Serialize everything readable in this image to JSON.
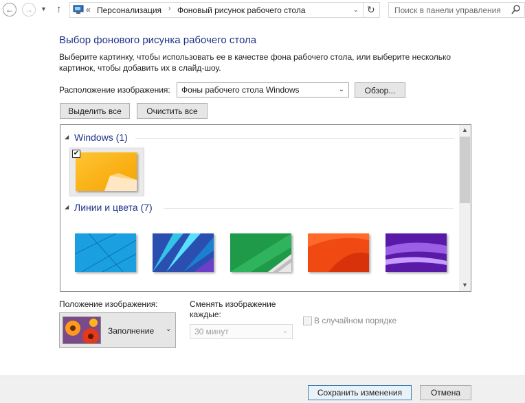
{
  "address": {
    "prefix": "«",
    "crumbs": [
      "Персонализация",
      "Фоновый рисунок рабочего стола"
    ],
    "search_placeholder": "Поиск в панели управления"
  },
  "heading": "Выбор фонового рисунка рабочего стола",
  "description": "Выберите картинку, чтобы использовать ее в качестве фона рабочего стола, или выберите несколько картинок, чтобы добавить их в слайд-шоу.",
  "location": {
    "label": "Расположение изображения:",
    "value": "Фоны рабочего стола Windows",
    "browse": "Обзор..."
  },
  "select_all": "Выделить все",
  "clear_all": "Очистить все",
  "groups": [
    {
      "name": "Windows (1)",
      "count": 1
    },
    {
      "name": "Линии и цвета (7)",
      "count": 7
    }
  ],
  "position": {
    "label": "Положение изображения:",
    "value": "Заполнение"
  },
  "interval": {
    "label": "Сменять изображение каждые:",
    "value": "30 минут"
  },
  "shuffle": {
    "label": "В случайном порядке",
    "checked": false
  },
  "footer": {
    "save": "Сохранить изменения",
    "cancel": "Отмена"
  }
}
